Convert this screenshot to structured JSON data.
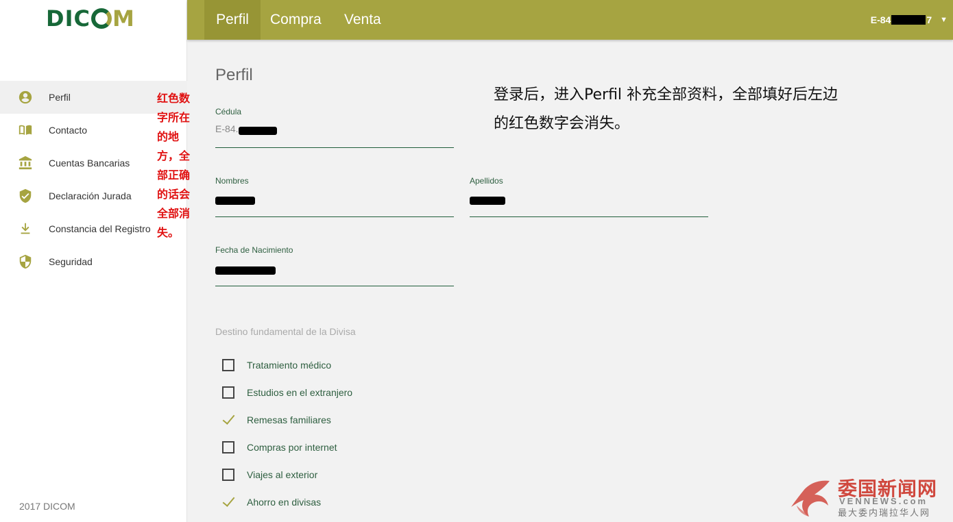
{
  "sidebar": {
    "logo": {
      "part1": "DIC",
      "part2": "M"
    },
    "items": [
      {
        "label": "Perfil",
        "icon": "account-circle-icon",
        "active": true
      },
      {
        "label": "Contacto",
        "icon": "book-icon",
        "active": false
      },
      {
        "label": "Cuentas Bancarias",
        "icon": "bank-icon",
        "active": false
      },
      {
        "label": "Declaración Jurada",
        "icon": "shield-check-icon",
        "active": false
      },
      {
        "label": "Constancia del Registro",
        "icon": "download-icon",
        "active": false
      },
      {
        "label": "Seguridad",
        "icon": "security-shield-icon",
        "active": false
      }
    ],
    "footer": "2017 DICOM"
  },
  "annotation_left": "红色数字所在的地方，全部正确的话会全部消失。",
  "annotation_main": "登录后，进入Perfil 补充全部资料，全部填好后左边的红色数字会消失。",
  "topbar": {
    "tabs": [
      {
        "label": "Perfil",
        "active": true
      },
      {
        "label": "Compra",
        "active": false
      },
      {
        "label": "Venta",
        "active": false
      }
    ],
    "user_prefix": "E-84",
    "user_suffix": "7"
  },
  "main": {
    "title": "Perfil",
    "cedula": {
      "label": "Cédula",
      "value": "E-84."
    },
    "nombres": {
      "label": "Nombres",
      "value": ""
    },
    "apellidos": {
      "label": "Apellidos",
      "value": ""
    },
    "fecha": {
      "label": "Fecha de Nacimiento",
      "value": ""
    },
    "destino_label": "Destino fundamental de la Divisa",
    "destinos": [
      {
        "label": "Tratamiento médico",
        "checked": false
      },
      {
        "label": "Estudios en el extranjero",
        "checked": false
      },
      {
        "label": "Remesas familiares",
        "checked": true
      },
      {
        "label": "Compras por internet",
        "checked": false
      },
      {
        "label": "Viajes al exterior",
        "checked": false
      },
      {
        "label": "Ahorro en divisas",
        "checked": true
      }
    ]
  },
  "watermark": {
    "line1": "委国新闻网",
    "line2": "VENNEWS.com",
    "line3": "最大委内瑞拉华人网"
  },
  "colors": {
    "accent": "#a6a441",
    "dark_green": "#176838",
    "note_red": "#e01010"
  }
}
